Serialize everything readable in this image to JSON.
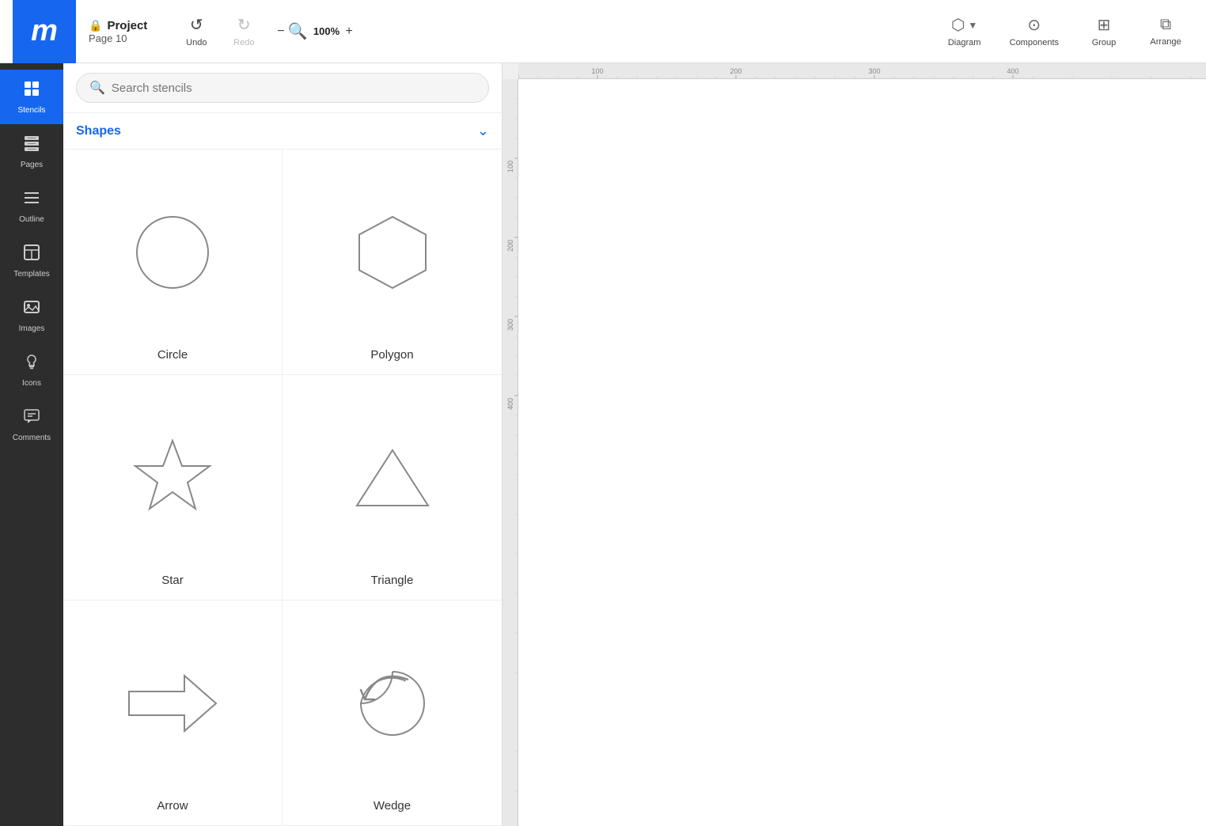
{
  "app": {
    "logo": "m",
    "project_title": "Project",
    "project_page": "Page 10"
  },
  "toolbar": {
    "undo_label": "Undo",
    "redo_label": "Redo",
    "zoom_minus": "−",
    "zoom_value": "100%",
    "zoom_plus": "+",
    "diagram_label": "Diagram",
    "components_label": "Components",
    "group_label": "Group",
    "arrange_label": "Arrange"
  },
  "left_nav": {
    "items": [
      {
        "id": "stencils",
        "label": "Stencils",
        "icon": "⊞",
        "active": true
      },
      {
        "id": "pages",
        "label": "Pages",
        "icon": "▤",
        "active": false
      },
      {
        "id": "outline",
        "label": "Outline",
        "icon": "≡",
        "active": false
      },
      {
        "id": "templates",
        "label": "Templates",
        "icon": "▦",
        "active": false
      },
      {
        "id": "images",
        "label": "Images",
        "icon": "🖼",
        "active": false
      },
      {
        "id": "icons",
        "label": "Icons",
        "icon": "♣",
        "active": false
      },
      {
        "id": "comments",
        "label": "Comments",
        "icon": "💬",
        "active": false
      }
    ]
  },
  "stencils_panel": {
    "search_placeholder": "Search stencils",
    "shapes_title": "Shapes",
    "shapes": [
      {
        "id": "circle",
        "label": "Circle"
      },
      {
        "id": "polygon",
        "label": "Polygon"
      },
      {
        "id": "star",
        "label": "Star"
      },
      {
        "id": "triangle",
        "label": "Triangle"
      },
      {
        "id": "arrow",
        "label": "Arrow"
      },
      {
        "id": "wedge",
        "label": "Wedge"
      }
    ]
  },
  "ruler": {
    "top_marks": [
      {
        "value": "100",
        "pos": 100
      },
      {
        "value": "200",
        "pos": 275
      },
      {
        "value": "300",
        "pos": 450
      },
      {
        "value": "400",
        "pos": 625
      }
    ],
    "left_marks": [
      {
        "value": "100",
        "pos": 100
      },
      {
        "value": "200",
        "pos": 200
      },
      {
        "value": "300",
        "pos": 300
      },
      {
        "value": "400",
        "pos": 400
      }
    ]
  },
  "colors": {
    "accent": "#1666f0",
    "nav_bg": "#2d2d2d",
    "toolbar_bg": "#ffffff",
    "canvas_bg": "#ffffff"
  }
}
